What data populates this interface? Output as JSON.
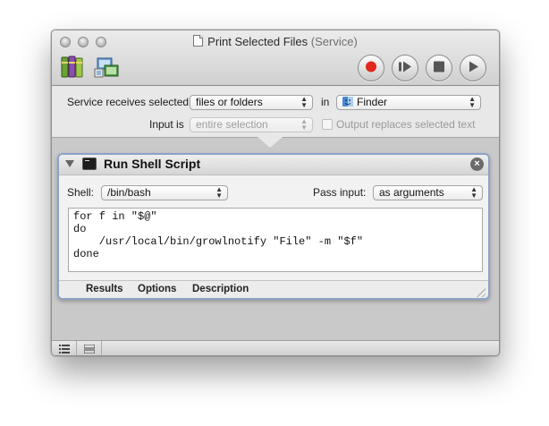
{
  "window": {
    "title": "Print Selected Files",
    "subtitle": "(Service)"
  },
  "toolbar": {
    "icons": [
      "library-icon",
      "media-icon"
    ],
    "controls": [
      "record-icon",
      "step-icon",
      "stop-icon",
      "run-icon"
    ],
    "record_color": "#e0281c"
  },
  "service": {
    "receives_label": "Service receives selected",
    "receives_value": "files or folders",
    "in_label": "in",
    "app_value": "Finder",
    "input_label": "Input is",
    "input_value": "entire selection",
    "output_replaces_label": "Output replaces selected text",
    "output_replaces_checked": false
  },
  "action": {
    "title": "Run Shell Script",
    "shell_label": "Shell:",
    "shell_value": "/bin/bash",
    "pass_input_label": "Pass input:",
    "pass_input_value": "as arguments",
    "script": "for f in \"$@\"\ndo\n    /usr/local/bin/growlnotify \"File\" -m \"$f\"\ndone",
    "tabs": [
      "Results",
      "Options",
      "Description"
    ]
  },
  "bottom_bar": {
    "icons": [
      "list-view-icon",
      "log-view-icon"
    ]
  },
  "colors": {
    "action_border": "#8ba3c8",
    "window_bg": "#d6d6d6"
  }
}
